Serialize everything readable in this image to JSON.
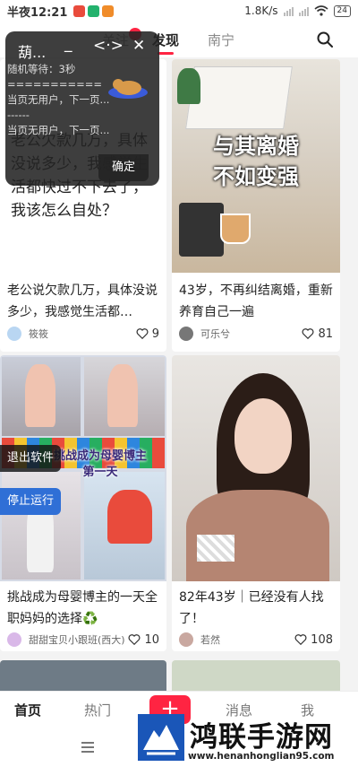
{
  "status_bar": {
    "time": "半夜12:21",
    "speed": "1.8K/s",
    "battery": "24",
    "colors": {
      "app1": "#e94b3c",
      "app2": "#23b26d",
      "app3": "#f08c2a"
    }
  },
  "top_nav": {
    "tabs": [
      {
        "label": "关注",
        "active": false
      },
      {
        "label": "发现",
        "active": true
      },
      {
        "label": "南宁",
        "active": false
      }
    ],
    "search_icon": "search-icon"
  },
  "overlay": {
    "title": "葫...",
    "minimize": "_",
    "expand": "<·>",
    "close": "✕",
    "log": "随机等待：3秒\n===========\n当页无用户，下一页...\n------\n当页无用户，下一页...",
    "confirm": "确定"
  },
  "side_buttons": {
    "exit": "退出软件",
    "stop": "停止运行"
  },
  "feed": {
    "cards": [
      {
        "image_text": "老公欠款几万，具体没说多少，我感觉生活都快过不下去了，我该怎么自处？",
        "title": "老公说欠款几万，具体没说多少，我感觉生活都…",
        "author": "筱筱",
        "likes": "9"
      },
      {
        "image_text": [
          "与其离婚",
          "不如变强"
        ],
        "title": "43岁，不再纠结离婚，重新养育自己一遍",
        "author": "可乐兮",
        "likes": "81"
      },
      {
        "image_text": [
          "挑战成为母婴博主",
          "第一天"
        ],
        "title": "挑战成为母婴博主的一天全职妈妈的选择♻️",
        "author": "甜甜宝贝小跟班(西大)",
        "likes": "10"
      },
      {
        "title": "82年43岁｜已经没有人找了！",
        "author": "若然",
        "likes": "108"
      }
    ]
  },
  "bottom_nav": {
    "items": [
      {
        "label": "首页",
        "active": true
      },
      {
        "label": "热门",
        "active": false
      },
      {
        "label": "消息",
        "active": false
      },
      {
        "label": "我",
        "active": false
      }
    ],
    "publish": "+"
  },
  "watermark": {
    "text": "鸿联手游网",
    "url": "www.henanhonglian95.com"
  },
  "colors": {
    "accent": "#ff2442",
    "overlay_bg": "#232323"
  }
}
